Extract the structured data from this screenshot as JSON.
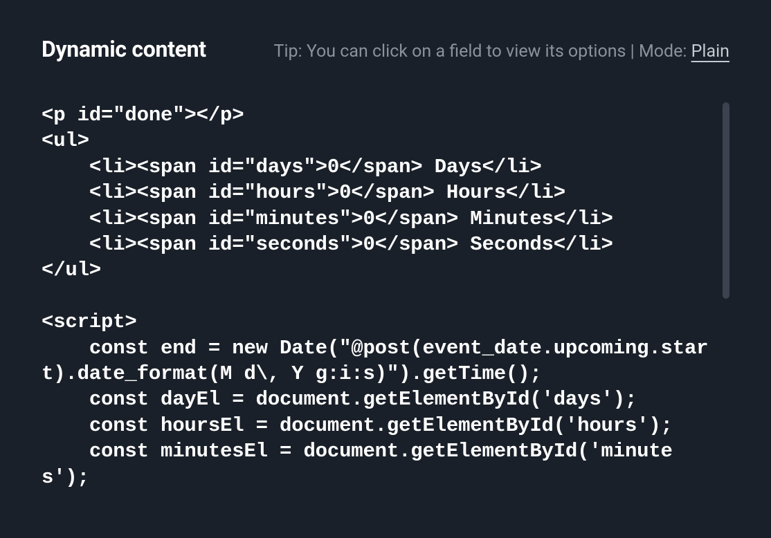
{
  "header": {
    "title": "Dynamic content",
    "hint_prefix": "Tip: You can click on a field to view its options | Mode: ",
    "mode_link": "Plain"
  },
  "code": "<p id=\"done\"></p>\n<ul>\n    <li><span id=\"days\">0</span> Days</li>\n    <li><span id=\"hours\">0</span> Hours</li>\n    <li><span id=\"minutes\">0</span> Minutes</li>\n    <li><span id=\"seconds\">0</span> Seconds</li>\n</ul>\n\n<script>\n    const end = new Date(\"@post(event_date.upcoming.start).date_format(M d\\, Y g:i:s)\").getTime();\n    const dayEl = document.getElementById('days');\n    const hoursEl = document.getElementById('hours');\n    const minutesEl = document.getElementById('minutes');"
}
